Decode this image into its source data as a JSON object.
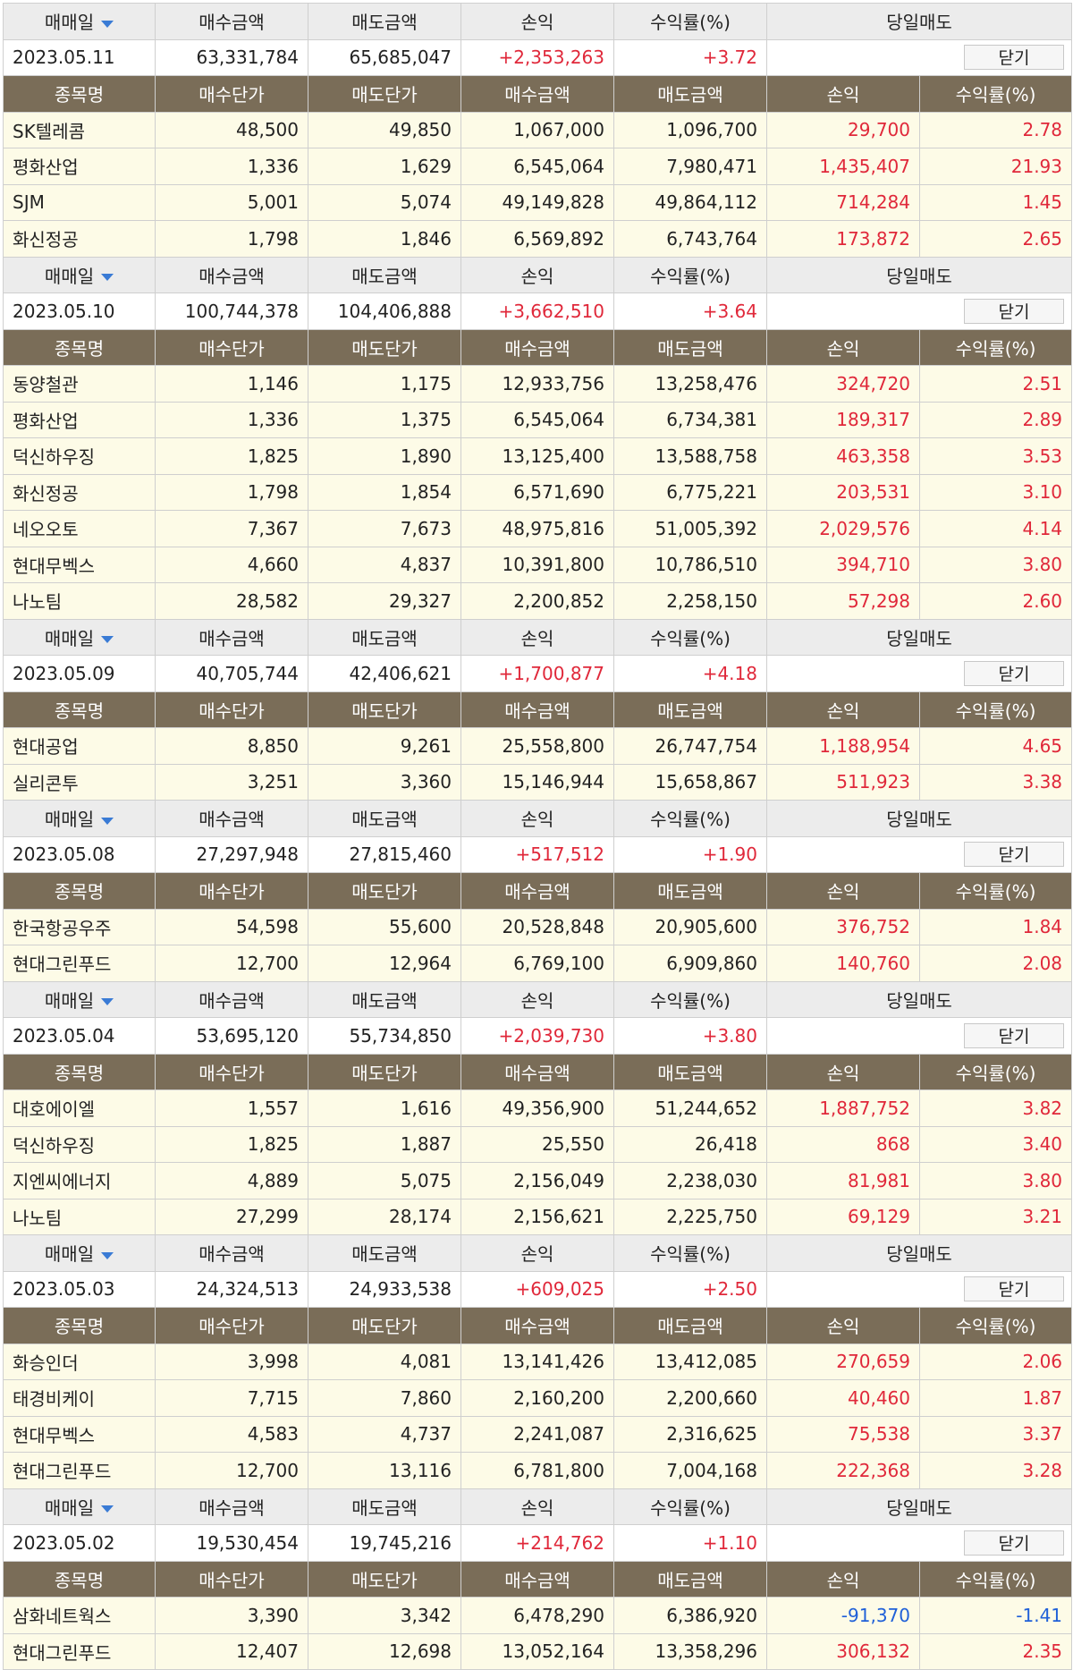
{
  "labels": {
    "date": "매매일",
    "buy_amount": "매수금액",
    "sell_amount": "매도금액",
    "profit": "손익",
    "return_rate": "수익률(%)",
    "same_day_sell": "당일매도",
    "close_button": "닫기",
    "stock_name": "종목명",
    "buy_price": "매수단가",
    "sell_price": "매도단가"
  },
  "colors": {
    "positive": "#e0283a",
    "negative": "#2060d8",
    "detail_header": "#7a6d58",
    "detail_row": "#fdfbe7",
    "sort_arrow": "#3a7bd5"
  },
  "days": [
    {
      "date": "2023.05.11",
      "buy": "63,331,784",
      "sell": "65,685,047",
      "profit": "+2,353,263",
      "rate": "+3.72",
      "stocks": [
        {
          "name": "SK텔레콤",
          "buy_price": "48,500",
          "sell_price": "49,850",
          "buy_amt": "1,067,000",
          "sell_amt": "1,096,700",
          "profit": "29,700",
          "rate": "2.78"
        },
        {
          "name": "평화산업",
          "buy_price": "1,336",
          "sell_price": "1,629",
          "buy_amt": "6,545,064",
          "sell_amt": "7,980,471",
          "profit": "1,435,407",
          "rate": "21.93"
        },
        {
          "name": "SJM",
          "buy_price": "5,001",
          "sell_price": "5,074",
          "buy_amt": "49,149,828",
          "sell_amt": "49,864,112",
          "profit": "714,284",
          "rate": "1.45"
        },
        {
          "name": "화신정공",
          "buy_price": "1,798",
          "sell_price": "1,846",
          "buy_amt": "6,569,892",
          "sell_amt": "6,743,764",
          "profit": "173,872",
          "rate": "2.65"
        }
      ]
    },
    {
      "date": "2023.05.10",
      "buy": "100,744,378",
      "sell": "104,406,888",
      "profit": "+3,662,510",
      "rate": "+3.64",
      "stocks": [
        {
          "name": "동양철관",
          "buy_price": "1,146",
          "sell_price": "1,175",
          "buy_amt": "12,933,756",
          "sell_amt": "13,258,476",
          "profit": "324,720",
          "rate": "2.51"
        },
        {
          "name": "평화산업",
          "buy_price": "1,336",
          "sell_price": "1,375",
          "buy_amt": "6,545,064",
          "sell_amt": "6,734,381",
          "profit": "189,317",
          "rate": "2.89"
        },
        {
          "name": "덕신하우징",
          "buy_price": "1,825",
          "sell_price": "1,890",
          "buy_amt": "13,125,400",
          "sell_amt": "13,588,758",
          "profit": "463,358",
          "rate": "3.53"
        },
        {
          "name": "화신정공",
          "buy_price": "1,798",
          "sell_price": "1,854",
          "buy_amt": "6,571,690",
          "sell_amt": "6,775,221",
          "profit": "203,531",
          "rate": "3.10"
        },
        {
          "name": "네오오토",
          "buy_price": "7,367",
          "sell_price": "7,673",
          "buy_amt": "48,975,816",
          "sell_amt": "51,005,392",
          "profit": "2,029,576",
          "rate": "4.14"
        },
        {
          "name": "현대무벡스",
          "buy_price": "4,660",
          "sell_price": "4,837",
          "buy_amt": "10,391,800",
          "sell_amt": "10,786,510",
          "profit": "394,710",
          "rate": "3.80"
        },
        {
          "name": "나노팀",
          "buy_price": "28,582",
          "sell_price": "29,327",
          "buy_amt": "2,200,852",
          "sell_amt": "2,258,150",
          "profit": "57,298",
          "rate": "2.60"
        }
      ]
    },
    {
      "date": "2023.05.09",
      "buy": "40,705,744",
      "sell": "42,406,621",
      "profit": "+1,700,877",
      "rate": "+4.18",
      "stocks": [
        {
          "name": "현대공업",
          "buy_price": "8,850",
          "sell_price": "9,261",
          "buy_amt": "25,558,800",
          "sell_amt": "26,747,754",
          "profit": "1,188,954",
          "rate": "4.65"
        },
        {
          "name": "실리콘투",
          "buy_price": "3,251",
          "sell_price": "3,360",
          "buy_amt": "15,146,944",
          "sell_amt": "15,658,867",
          "profit": "511,923",
          "rate": "3.38"
        }
      ]
    },
    {
      "date": "2023.05.08",
      "buy": "27,297,948",
      "sell": "27,815,460",
      "profit": "+517,512",
      "rate": "+1.90",
      "stocks": [
        {
          "name": "한국항공우주",
          "buy_price": "54,598",
          "sell_price": "55,600",
          "buy_amt": "20,528,848",
          "sell_amt": "20,905,600",
          "profit": "376,752",
          "rate": "1.84"
        },
        {
          "name": "현대그린푸드",
          "buy_price": "12,700",
          "sell_price": "12,964",
          "buy_amt": "6,769,100",
          "sell_amt": "6,909,860",
          "profit": "140,760",
          "rate": "2.08"
        }
      ]
    },
    {
      "date": "2023.05.04",
      "buy": "53,695,120",
      "sell": "55,734,850",
      "profit": "+2,039,730",
      "rate": "+3.80",
      "stocks": [
        {
          "name": "대호에이엘",
          "buy_price": "1,557",
          "sell_price": "1,616",
          "buy_amt": "49,356,900",
          "sell_amt": "51,244,652",
          "profit": "1,887,752",
          "rate": "3.82"
        },
        {
          "name": "덕신하우징",
          "buy_price": "1,825",
          "sell_price": "1,887",
          "buy_amt": "25,550",
          "sell_amt": "26,418",
          "profit": "868",
          "rate": "3.40"
        },
        {
          "name": "지엔씨에너지",
          "buy_price": "4,889",
          "sell_price": "5,075",
          "buy_amt": "2,156,049",
          "sell_amt": "2,238,030",
          "profit": "81,981",
          "rate": "3.80"
        },
        {
          "name": "나노팀",
          "buy_price": "27,299",
          "sell_price": "28,174",
          "buy_amt": "2,156,621",
          "sell_amt": "2,225,750",
          "profit": "69,129",
          "rate": "3.21"
        }
      ]
    },
    {
      "date": "2023.05.03",
      "buy": "24,324,513",
      "sell": "24,933,538",
      "profit": "+609,025",
      "rate": "+2.50",
      "stocks": [
        {
          "name": "화승인더",
          "buy_price": "3,998",
          "sell_price": "4,081",
          "buy_amt": "13,141,426",
          "sell_amt": "13,412,085",
          "profit": "270,659",
          "rate": "2.06"
        },
        {
          "name": "태경비케이",
          "buy_price": "7,715",
          "sell_price": "7,860",
          "buy_amt": "2,160,200",
          "sell_amt": "2,200,660",
          "profit": "40,460",
          "rate": "1.87"
        },
        {
          "name": "현대무벡스",
          "buy_price": "4,583",
          "sell_price": "4,737",
          "buy_amt": "2,241,087",
          "sell_amt": "2,316,625",
          "profit": "75,538",
          "rate": "3.37"
        },
        {
          "name": "현대그린푸드",
          "buy_price": "12,700",
          "sell_price": "13,116",
          "buy_amt": "6,781,800",
          "sell_amt": "7,004,168",
          "profit": "222,368",
          "rate": "3.28"
        }
      ]
    },
    {
      "date": "2023.05.02",
      "buy": "19,530,454",
      "sell": "19,745,216",
      "profit": "+214,762",
      "rate": "+1.10",
      "stocks": [
        {
          "name": "삼화네트웍스",
          "buy_price": "3,390",
          "sell_price": "3,342",
          "buy_amt": "6,478,290",
          "sell_amt": "6,386,920",
          "profit": "-91,370",
          "rate": "-1.41"
        },
        {
          "name": "현대그린푸드",
          "buy_price": "12,407",
          "sell_price": "12,698",
          "buy_amt": "13,052,164",
          "sell_amt": "13,358,296",
          "profit": "306,132",
          "rate": "2.35"
        }
      ]
    }
  ]
}
